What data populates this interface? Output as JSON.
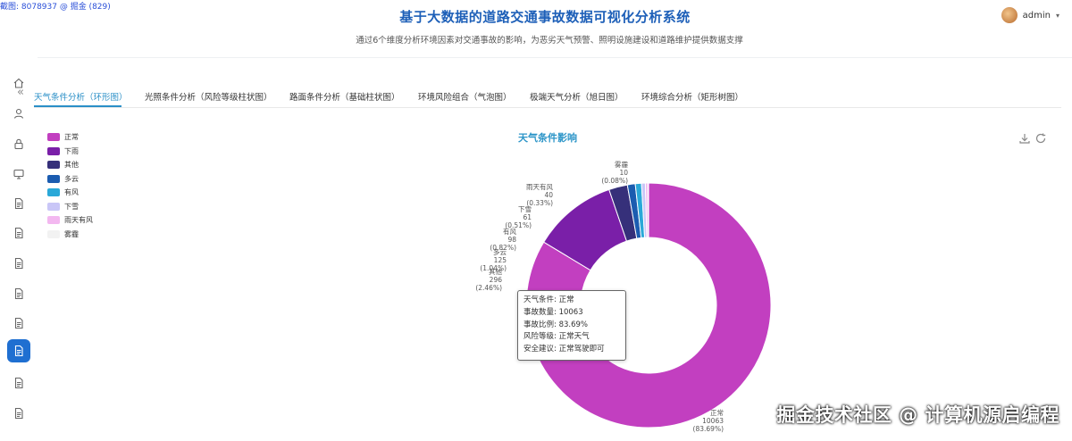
{
  "corner_text": "截图: 8078937 @ 掘金 (829)",
  "header": {
    "title": "基于大数据的道路交通事故数据可视化分析系统",
    "subtitle": "通过6个维度分析环境因素对交通事故的影响，为恶劣天气预警、照明设施建设和道路维护提供数据支撑",
    "user_name": "admin"
  },
  "tabs": [
    {
      "label": "天气条件分析（环形图）"
    },
    {
      "label": "光照条件分析（风险等级柱状图）"
    },
    {
      "label": "路面条件分析（基础柱状图）"
    },
    {
      "label": "环境风险组合（气泡图）"
    },
    {
      "label": "极端天气分析（旭日图）"
    },
    {
      "label": "环境综合分析（矩形树图）"
    }
  ],
  "sidebar_icons": [
    "home-icon",
    "user-icon",
    "lock-icon",
    "monitor-icon",
    "document-icon",
    "document-icon",
    "document-icon",
    "document-icon",
    "document-icon",
    "document-icon",
    "document-icon",
    "document-icon"
  ],
  "colors": {
    "accent": "#1f6fd1",
    "title": "#1d5fb8",
    "chart_title": "#2c95c8"
  },
  "chart_data": {
    "type": "pie",
    "title": "天气条件影响",
    "donut": true,
    "legend_position": "left",
    "series": [
      {
        "name": "正常",
        "value": 10063,
        "label_pct": "(83.69%)",
        "color": "#c23fc0"
      },
      {
        "name": "下雨",
        "value": 1337,
        "label_pct": "",
        "color": "#7a1fa8"
      },
      {
        "name": "其他",
        "value": 296,
        "label_pct": "(2.46%)",
        "color": "#36307a"
      },
      {
        "name": "多云",
        "value": 125,
        "label_pct": "(1.04%)",
        "color": "#1b5cb0"
      },
      {
        "name": "有风",
        "value": 98,
        "label_pct": "(0.82%)",
        "color": "#2aa8d8"
      },
      {
        "name": "下雪",
        "value": 61,
        "label_pct": "(0.51%)",
        "color": "#c9c6f7"
      },
      {
        "name": "雨天有风",
        "value": 40,
        "label_pct": "(0.33%)",
        "color": "#f3b8f0"
      },
      {
        "name": "雾霾",
        "value": 10,
        "label_pct": "(0.08%)",
        "color": "#f2f2f2"
      }
    ],
    "tooltip": [
      "天气条件: 正常",
      "事故数量: 10063",
      "事故比例: 83.69%",
      "风险等级: 正常天气",
      "安全建议: 正常驾驶即可"
    ]
  },
  "watermark": "掘金技术社区 @ 计算机源启编程"
}
